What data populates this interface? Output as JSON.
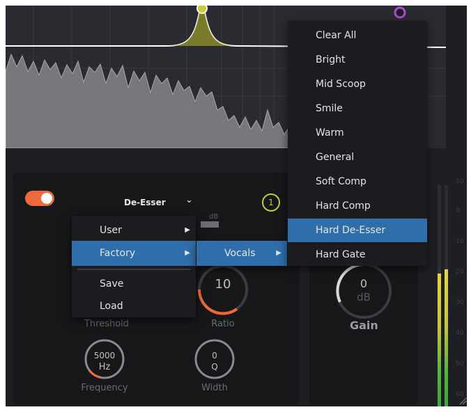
{
  "deesser": {
    "title": "De-Esser",
    "band_badge": "1",
    "scale_unit": "dB",
    "threshold_label": "Threshold",
    "ratio_value": "10",
    "ratio_label": "Ratio",
    "frequency_value": "5000",
    "frequency_unit": "Hz",
    "frequency_label": "Frequency",
    "width_value": "0",
    "width_unit": "Q",
    "width_label": "Width",
    "enabled": true,
    "accent_color": "#ee6a3c"
  },
  "gain_panel": {
    "value": "0",
    "unit": "dB",
    "label": "Gain"
  },
  "meters": {
    "scale": [
      "10",
      "0",
      "10",
      "20",
      "30",
      "40",
      "50",
      "60"
    ],
    "left_level": 0.6,
    "right_level": 0.62
  },
  "preset_menu": {
    "items": [
      {
        "label": "User",
        "has_submenu": true
      },
      {
        "label": "Factory",
        "has_submenu": true,
        "selected": true
      },
      {
        "label": "Save"
      },
      {
        "label": "Load"
      }
    ]
  },
  "factory_submenu": {
    "items": [
      {
        "label": "Vocals",
        "has_submenu": true,
        "selected": true
      }
    ]
  },
  "vocals_submenu": {
    "items": [
      {
        "label": "Clear All"
      },
      {
        "label": "Bright"
      },
      {
        "label": "Mid Scoop"
      },
      {
        "label": "Smile"
      },
      {
        "label": "Warm"
      },
      {
        "label": "General"
      },
      {
        "label": "Soft Comp"
      },
      {
        "label": "Hard Comp"
      },
      {
        "label": "Hard De-Esser",
        "selected": true
      },
      {
        "label": "Hard Gate"
      }
    ]
  },
  "colors": {
    "selection": "#2f6ea8",
    "eq_node": "#c9c93a",
    "eq_node_2": "#b04bd0",
    "band_badge": "#b9d13a"
  }
}
